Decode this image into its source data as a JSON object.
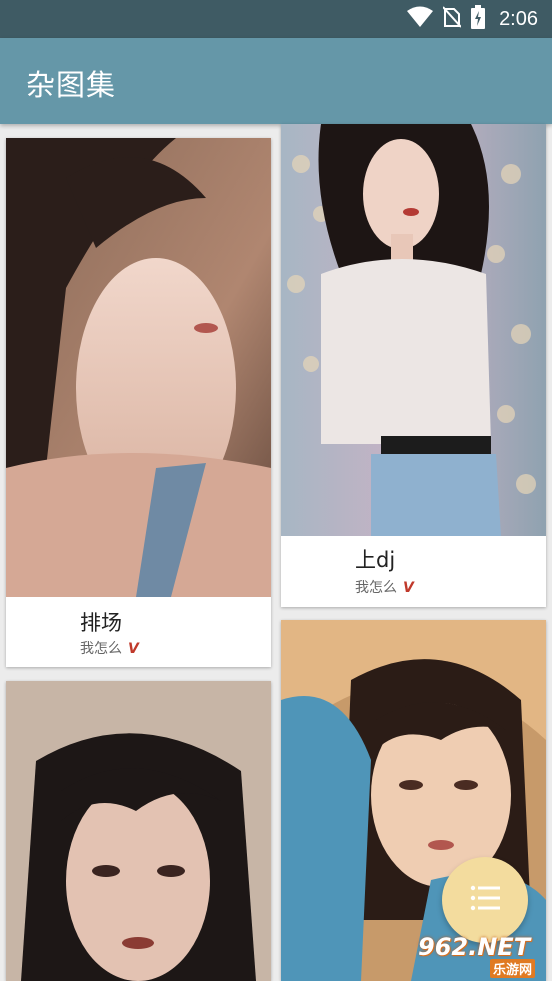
{
  "status_bar": {
    "time": "2:06",
    "icons": [
      "wifi-icon",
      "no-sim-icon",
      "battery-charging-icon"
    ]
  },
  "app_bar": {
    "title": "杂图集",
    "background_color": "#6597a8"
  },
  "gallery": {
    "items": [
      {
        "title": "排场",
        "author": "我怎么",
        "badge": "V"
      },
      {
        "title": "上dj",
        "author": "我怎么",
        "badge": "V"
      },
      {
        "title": "",
        "author": "",
        "badge": ""
      },
      {
        "title": "",
        "author": "",
        "badge": ""
      }
    ]
  },
  "fab": {
    "icon": "list-menu-icon",
    "color": "#f3dc9e"
  },
  "watermark": {
    "logo": "962.NET",
    "sub": "乐游网"
  }
}
